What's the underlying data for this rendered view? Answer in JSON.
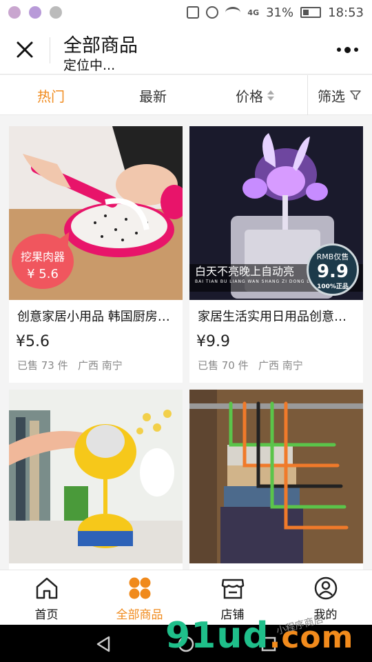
{
  "status_bar": {
    "network": "4G",
    "battery": "31%",
    "time": "18:53"
  },
  "header": {
    "title": "全部商品",
    "subtitle": "定位中..."
  },
  "sort_bar": {
    "tabs": [
      {
        "label": "热门",
        "active": true
      },
      {
        "label": "最新",
        "active": false
      },
      {
        "label": "价格",
        "active": false
      }
    ],
    "filter_label": "筛选"
  },
  "products": [
    {
      "name": "创意家居小用品 韩国厨房水果挖勺",
      "price": "¥5.6",
      "sold": "已售 73 件",
      "location": "广西 南宁",
      "badge_line1": "挖果肉器",
      "badge_line2": "¥ 5.6"
    },
    {
      "name": "家居生活实用日用品创意感应小夜灯",
      "price": "¥9.9",
      "sold": "已售 70 件",
      "location": "广西 南宁",
      "caption": "白天不亮晚上自动亮",
      "caption_sub": "BAI TIAN BU LIANG WAN SHANG ZI DONG LIANG",
      "rmb_top": "RMB仅售",
      "rmb_value": "9.9",
      "rmb_bottom": "100%正品"
    },
    {},
    {}
  ],
  "bottom_nav": {
    "items": [
      {
        "label": "首页",
        "icon": "home-icon",
        "active": false
      },
      {
        "label": "全部商品",
        "icon": "grid-icon",
        "active": true
      },
      {
        "label": "店铺",
        "icon": "store-icon",
        "active": false
      },
      {
        "label": "我的",
        "icon": "user-icon",
        "active": false
      }
    ]
  },
  "watermark": {
    "main": "91ud",
    "domain": ".com",
    "sub": "小程序商店"
  },
  "colors": {
    "accent": "#f08a1c",
    "badge_red": "#f0565e"
  }
}
